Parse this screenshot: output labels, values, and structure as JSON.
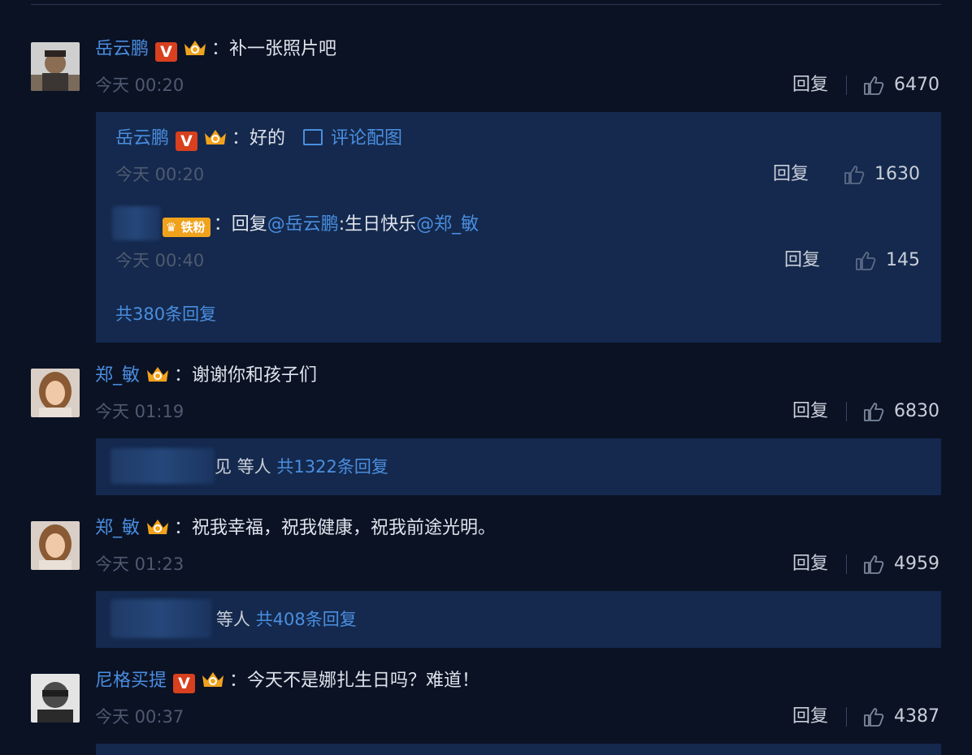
{
  "comments": [
    {
      "username": "岳云鹏",
      "verified_badge": "V",
      "separator": "：",
      "text": "补一张照片吧",
      "time": "今天 00:20",
      "reply_label": "回复",
      "likes": "6470",
      "replies": [
        {
          "username": "岳云鹏",
          "verified_badge": "V",
          "separator": "：",
          "text": "好的",
          "image_link": "评论配图",
          "time": "今天 00:20",
          "reply_label": "回复",
          "likes": "1630"
        },
        {
          "fan_badge": "铁粉",
          "separator": "：",
          "text_prefix": "回复",
          "mention_1": "@岳云鹏",
          "text_mid": ":生日快乐",
          "mention_2": "@郑_敏",
          "time": "今天 00:40",
          "reply_label": "回复",
          "likes": "145"
        }
      ],
      "total_replies": "共380条回复"
    },
    {
      "username": "郑_敏",
      "separator": "：",
      "text": "谢谢你和孩子们",
      "time": "今天 01:19",
      "reply_label": "回复",
      "likes": "6830",
      "summary_visible": "见",
      "summary_people": "等人",
      "total_replies": "共1322条回复"
    },
    {
      "username": "郑_敏",
      "separator": "：",
      "text": "祝我幸福，祝我健康，祝我前途光明。",
      "time": "今天 01:23",
      "reply_label": "回复",
      "likes": "4959",
      "summary_people": "等人",
      "total_replies": "共408条回复"
    },
    {
      "username": "尼格买提",
      "verified_badge": "V",
      "separator": "：",
      "text": "今天不是娜扎生日吗？难道！",
      "time": "今天 00:37",
      "reply_label": "回复",
      "likes": "4387"
    }
  ],
  "icons": {
    "like": "thumbs-up-icon",
    "crown": "vip-crown-icon",
    "image": "image-icon"
  },
  "colors": {
    "background": "#0b1224",
    "panel": "#14294d",
    "link": "#4a8ee0",
    "verified": "#d8401e",
    "crown": "#f0a21c"
  }
}
